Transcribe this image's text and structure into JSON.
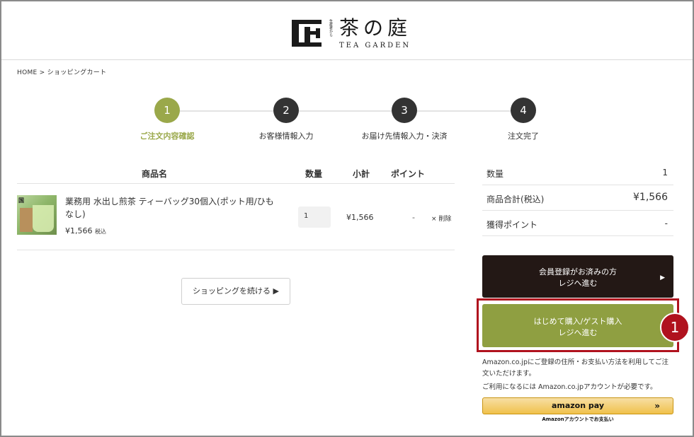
{
  "header": {
    "logo_jp": "茶の庭",
    "logo_en": "TEA GARDEN",
    "logo_vertical": "生産者から"
  },
  "breadcrumb": "HOME > ショッピングカート",
  "steps": [
    {
      "num": "1",
      "label": "ご注文内容確認",
      "active": true
    },
    {
      "num": "2",
      "label": "お客様情報入力",
      "active": false
    },
    {
      "num": "3",
      "label": "お届け先情報入力・決済",
      "active": false
    },
    {
      "num": "4",
      "label": "注文完了",
      "active": false
    }
  ],
  "cart": {
    "headers": {
      "name": "商品名",
      "qty": "数量",
      "subtotal": "小計",
      "points": "ポイント"
    },
    "item": {
      "thumb_tag": "国",
      "name": "業務用 水出し煎茶 ティーバッグ30個入(ポット用/ひもなし)",
      "price": "¥1,566",
      "tax": "税込",
      "qty": "1",
      "subtotal": "¥1,566",
      "points": "-",
      "delete": "× 削除"
    },
    "continue_label": "ショッピングを続ける ▶"
  },
  "summary": {
    "rows": [
      {
        "k": "数量",
        "v": "1"
      },
      {
        "k": "商品合計(税込)",
        "v": "¥1,566"
      },
      {
        "k": "獲得ポイント",
        "v": "-"
      }
    ]
  },
  "buttons": {
    "member_line1": "会員登録がお済みの方",
    "member_line2": "レジへ進む",
    "member_arrow": "▶",
    "guest_line1": "はじめて購入/ゲスト購入",
    "guest_line2": "レジへ進む",
    "badge": "1"
  },
  "amazon": {
    "note1": "Amazon.co.jpにご登録の住所・お支払い方法を利用してご注文いただけます。",
    "note2": "ご利用になるには Amazon.co.jpアカウントが必要です。",
    "btn_label": "amazon pay",
    "btn_chevron": "»",
    "caption": "Amazonアカウントでお支払い"
  },
  "colors": {
    "accent": "#9aa84a",
    "dark": "#231815",
    "highlight": "#b0121e"
  }
}
